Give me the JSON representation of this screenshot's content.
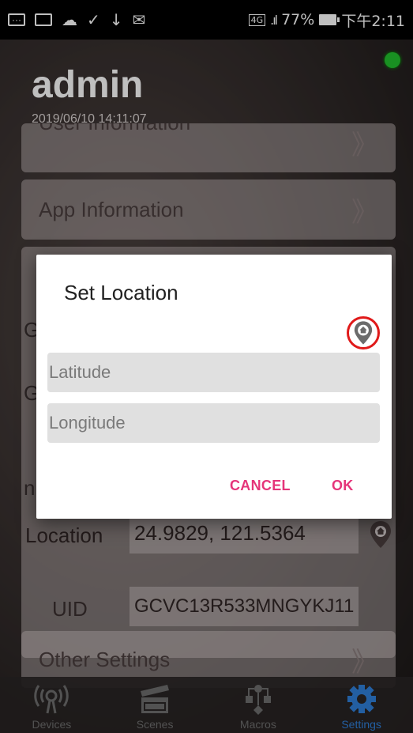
{
  "status_bar": {
    "network": "4G",
    "battery": "77%",
    "time": "下午2:11"
  },
  "header": {
    "title": "admin",
    "timestamp": "2019/06/10 14:11:07"
  },
  "settings": {
    "partial_item": "User Information",
    "app_information": "App Information",
    "chevron": "》",
    "side_letters": [
      "G",
      "G",
      "n"
    ],
    "location_label": "Location",
    "location_value": "24.9829, 121.5364",
    "uid_label": "UID",
    "uid_value": "GCVC13R533MNGYKJ11",
    "other_settings": "Other Settings"
  },
  "bottom_nav": [
    {
      "label": "Devices",
      "icon": "antenna-icon"
    },
    {
      "label": "Scenes",
      "icon": "clapperboard-icon"
    },
    {
      "label": "Macros",
      "icon": "flow-icon"
    },
    {
      "label": "Settings",
      "icon": "gear-icon"
    }
  ],
  "dialog": {
    "title": "Set Location",
    "latitude_placeholder": "Latitude",
    "longitude_placeholder": "Longitude",
    "cancel_label": "CANCEL",
    "ok_label": "OK"
  },
  "colors": {
    "accent": "#e5357a",
    "status_online": "#22c22e",
    "highlight_ring": "#e01a1a",
    "nav_active": "#2f7fd9"
  }
}
